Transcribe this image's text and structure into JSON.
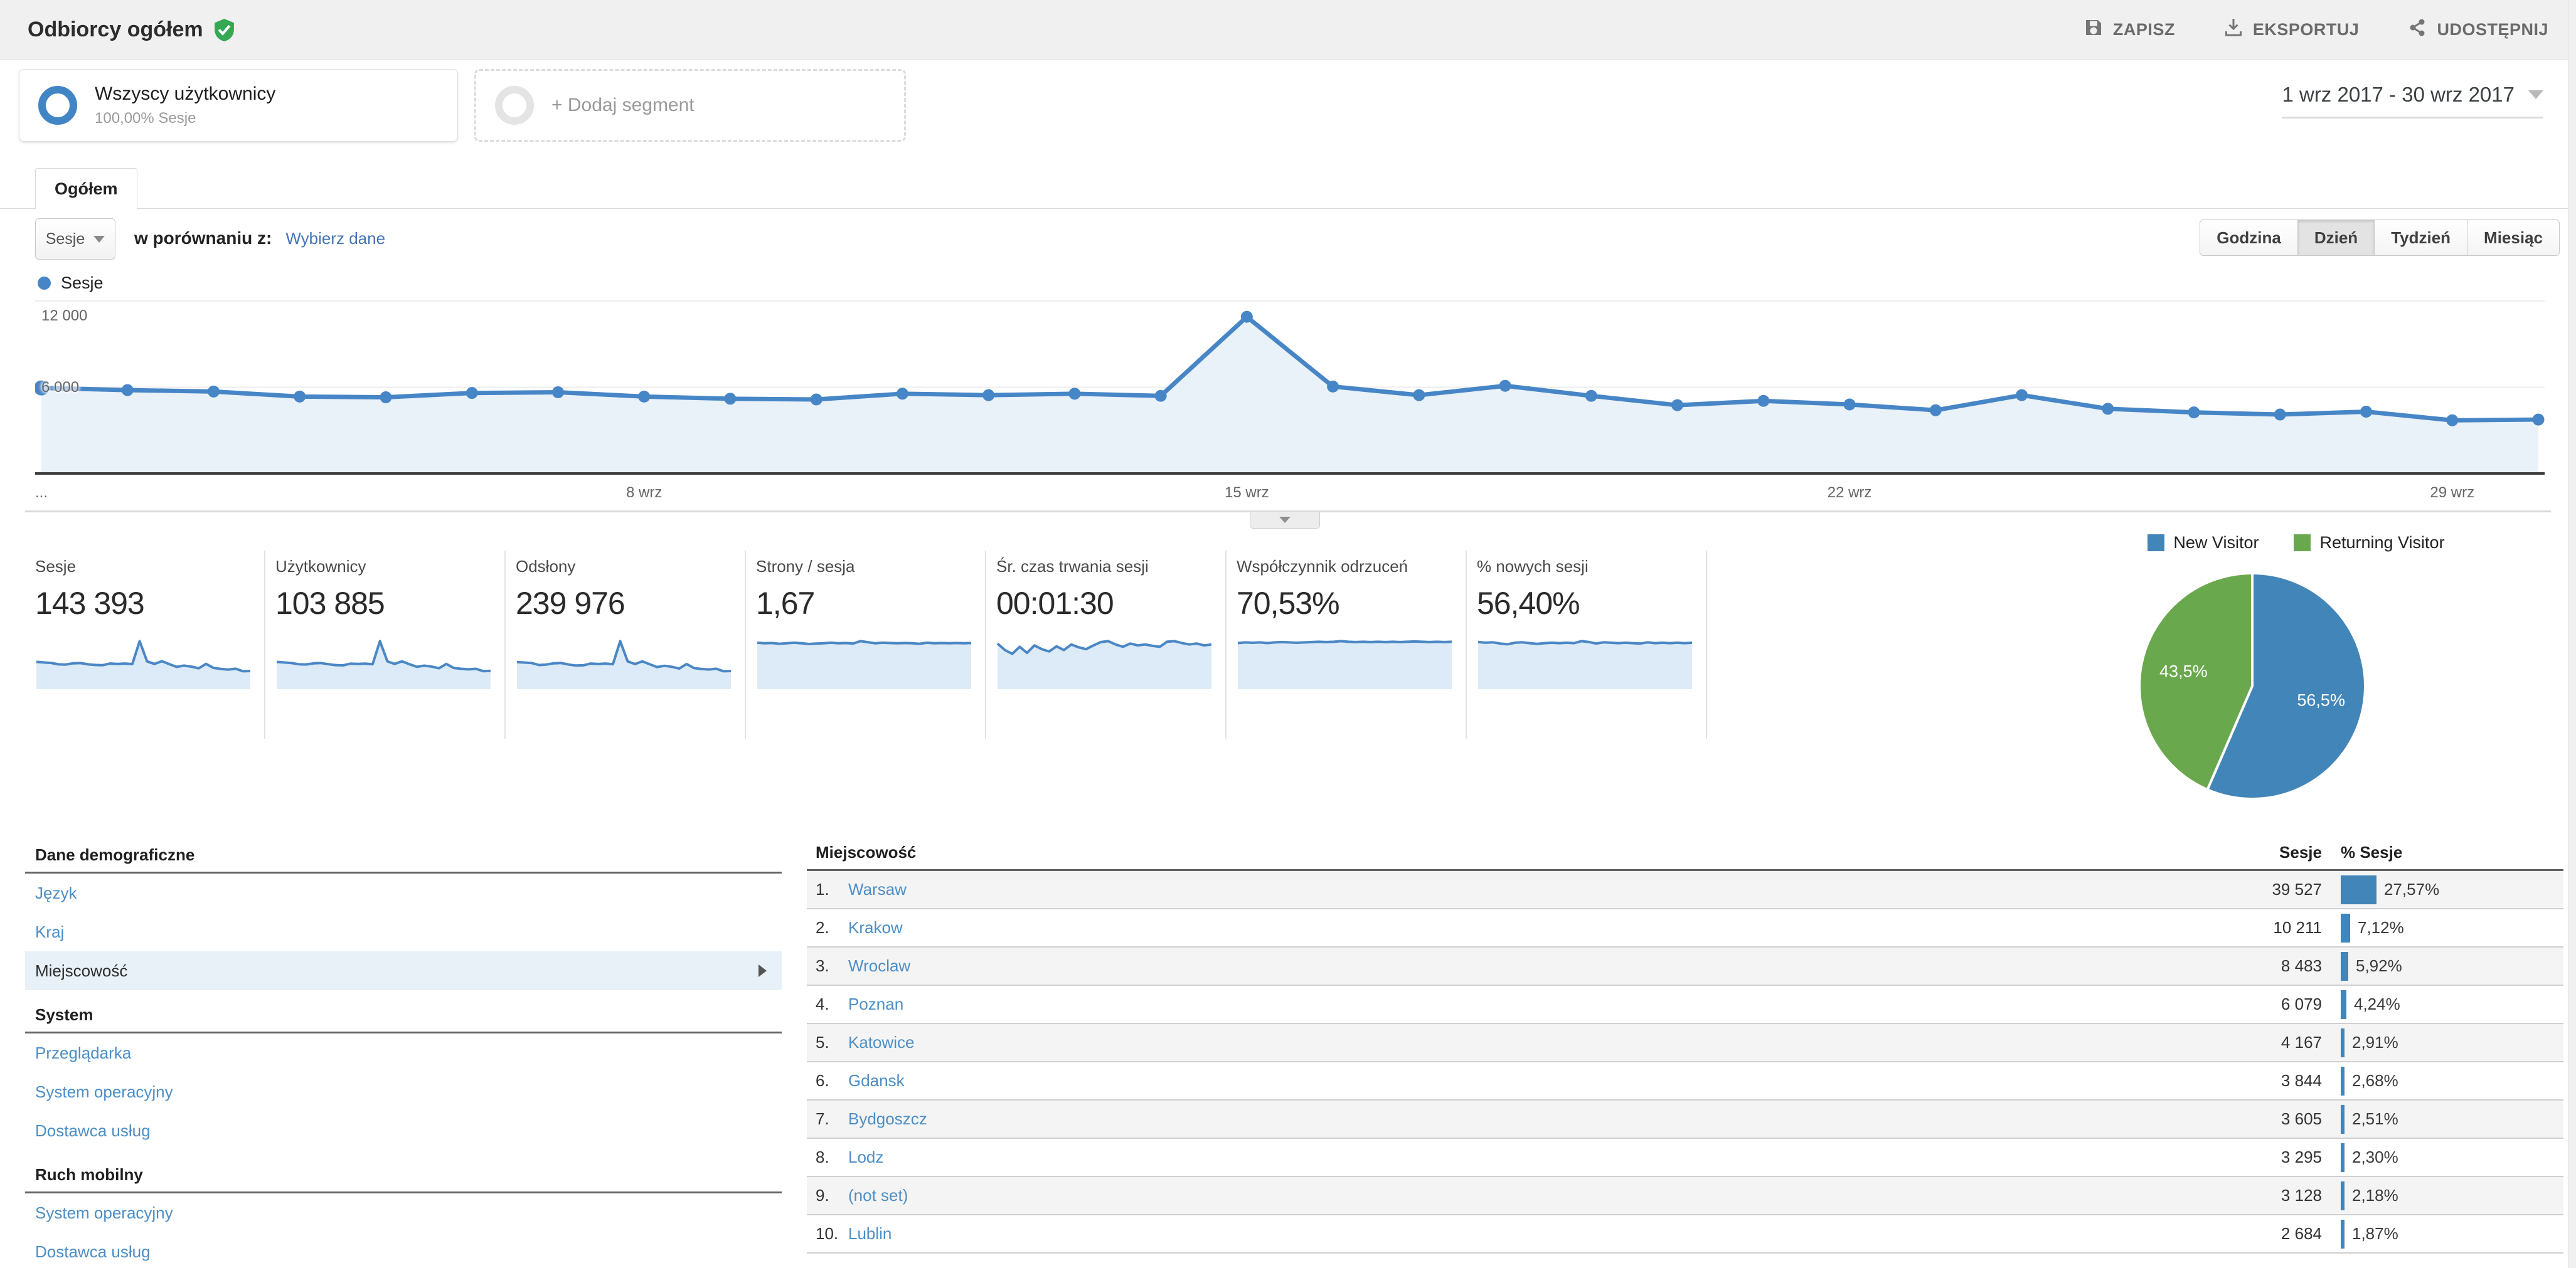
{
  "header": {
    "title": "Odbiorcy ogółem",
    "verified_icon": "shield-check-icon",
    "actions": [
      {
        "id": "save",
        "icon": "save-icon",
        "label": "ZAPISZ"
      },
      {
        "id": "export",
        "icon": "download-icon",
        "label": "EKSPORTUJ"
      },
      {
        "id": "share",
        "icon": "share-icon",
        "label": "UDOSTĘPNIJ"
      }
    ]
  },
  "segments": {
    "active": {
      "name": "Wszyscy użytkownicy",
      "detail": "100,00% Sesje"
    },
    "add_label": "+ Dodaj segment"
  },
  "date_range": "1 wrz 2017 - 30 wrz 2017",
  "tab_label": "Ogółem",
  "controls": {
    "metric_select": "Sesje",
    "compare_label": "w porównaniu z:",
    "compare_link": "Wybierz dane",
    "granularity": [
      "Godzina",
      "Dzień",
      "Tydzień",
      "Miesiąc"
    ],
    "granularity_active": "Dzień"
  },
  "colors": {
    "line_blue": "#4786c6",
    "area_blue": "#e9f1f9",
    "pie_blue": "#4285b8",
    "pie_green": "#6aa84e",
    "bar_blue": "#4285b8"
  },
  "chart_data": [
    {
      "id": "sessions_daily",
      "type": "line",
      "title": "Sesje",
      "x_unit": "day of wrz 2017",
      "x": [
        1,
        2,
        3,
        4,
        5,
        6,
        7,
        8,
        9,
        10,
        11,
        12,
        13,
        14,
        15,
        16,
        17,
        18,
        19,
        20,
        21,
        22,
        23,
        24,
        25,
        26,
        27,
        28,
        29,
        30
      ],
      "series": [
        {
          "name": "Sesje",
          "values": [
            5950,
            5800,
            5700,
            5350,
            5300,
            5600,
            5650,
            5350,
            5200,
            5150,
            5550,
            5450,
            5550,
            5400,
            10900,
            6050,
            5450,
            6100,
            5400,
            4750,
            5050,
            4800,
            4400,
            5450,
            4500,
            4250,
            4100,
            4300,
            3700,
            3750
          ]
        }
      ],
      "ylim": [
        0,
        13100
      ],
      "yticks": [
        {
          "value": 6000,
          "label": "6 000"
        },
        {
          "value": 12000,
          "label": "12 000"
        }
      ],
      "xticks": [
        {
          "index": 7,
          "label": "8 wrz"
        },
        {
          "index": 14,
          "label": "15 wrz"
        },
        {
          "index": 21,
          "label": "22 wrz"
        },
        {
          "index": 28,
          "label": "29 wrz"
        }
      ],
      "leading_xtick_label": "...",
      "grid": true,
      "legend_position": "top-left"
    },
    {
      "id": "visitor_type",
      "type": "pie",
      "slices": [
        {
          "label": "New Visitor",
          "value": 56.5,
          "display": "56,5%",
          "color": "#4285b8"
        },
        {
          "label": "Returning Visitor",
          "value": 43.5,
          "display": "43,5%",
          "color": "#6aa84e"
        }
      ],
      "legend_position": "top"
    }
  ],
  "metrics": [
    {
      "label": "Sesje",
      "value": "143 393",
      "spark": [
        5950,
        5800,
        5700,
        5350,
        5300,
        5600,
        5650,
        5350,
        5200,
        5150,
        5550,
        5450,
        5550,
        5400,
        10900,
        6050,
        5450,
        6100,
        5400,
        4750,
        5050,
        4800,
        4400,
        5450,
        4500,
        4250,
        4100,
        4300,
        3700,
        3750
      ]
    },
    {
      "label": "Użytkownicy",
      "value": "103 885",
      "spark": [
        4300,
        4200,
        4100,
        3900,
        3850,
        4050,
        4100,
        3900,
        3750,
        3700,
        4000,
        3950,
        4000,
        3900,
        7900,
        4400,
        3950,
        4400,
        3900,
        3450,
        3650,
        3500,
        3200,
        3950,
        3250,
        3100,
        3000,
        3100,
        2700,
        2750
      ]
    },
    {
      "label": "Odsłony",
      "value": "239 976",
      "spark": [
        9900,
        9700,
        9500,
        8700,
        8900,
        9400,
        9500,
        8900,
        8500,
        8600,
        9300,
        9100,
        9300,
        9000,
        18300,
        10200,
        9100,
        10200,
        9000,
        7900,
        8400,
        8000,
        7300,
        9100,
        7500,
        7100,
        6900,
        7200,
        6200,
        6300
      ]
    },
    {
      "label": "Strony / sesja",
      "value": "1,67",
      "spark": [
        1.68,
        1.66,
        1.67,
        1.64,
        1.66,
        1.68,
        1.66,
        1.63,
        1.65,
        1.66,
        1.68,
        1.66,
        1.67,
        1.65,
        1.74,
        1.7,
        1.66,
        1.68,
        1.67,
        1.66,
        1.67,
        1.66,
        1.64,
        1.68,
        1.66,
        1.67,
        1.66,
        1.67,
        1.66,
        1.67
      ]
    },
    {
      "label": "Śr. czas trwania sesji",
      "value": "00:01:30",
      "spark": [
        92,
        78,
        70,
        85,
        72,
        88,
        80,
        75,
        86,
        78,
        90,
        84,
        80,
        88,
        95,
        97,
        90,
        85,
        92,
        88,
        90,
        87,
        85,
        96,
        97,
        93,
        90,
        92,
        88,
        90
      ]
    },
    {
      "label": "Współczynnik odrzuceń",
      "value": "70,53%",
      "spark": [
        69,
        70,
        69.5,
        70,
        69,
        70,
        70.5,
        70,
        69.5,
        70,
        70.5,
        71,
        70.5,
        71,
        72,
        71,
        70.5,
        71,
        70.5,
        71,
        70.5,
        71,
        70.5,
        71,
        71.5,
        71,
        70.5,
        71,
        70.5,
        71
      ]
    },
    {
      "label": "% nowych sesji",
      "value": "56,40%",
      "spark": [
        57,
        56,
        56.5,
        55,
        54,
        56,
        56.5,
        55.5,
        54.5,
        55.5,
        56,
        55.5,
        56,
        55.5,
        58,
        57,
        55,
        56.5,
        56,
        55.5,
        56,
        55.5,
        55,
        56.5,
        55.5,
        56,
        55.5,
        56,
        55.5,
        56
      ]
    }
  ],
  "nav": {
    "sections": [
      {
        "title": "Dane demograficzne",
        "items": [
          {
            "id": "jezyk",
            "label": "Język"
          },
          {
            "id": "kraj",
            "label": "Kraj"
          },
          {
            "id": "miejscowosc",
            "label": "Miejscowość",
            "selected": true
          }
        ]
      },
      {
        "title": "System",
        "items": [
          {
            "id": "przegladarka",
            "label": "Przeglądarka"
          },
          {
            "id": "system-operacyjny",
            "label": "System operacyjny"
          },
          {
            "id": "dostawca-uslug",
            "label": "Dostawca usług"
          }
        ]
      },
      {
        "title": "Ruch mobilny",
        "items": [
          {
            "id": "mobilny-system-operacyjny",
            "label": "System operacyjny"
          },
          {
            "id": "mobilny-dostawca-uslug",
            "label": "Dostawca usług"
          }
        ]
      }
    ]
  },
  "table": {
    "headers": [
      "Miejscowość",
      "Sesje",
      "% Sesje"
    ],
    "rows": [
      {
        "rank": "1.",
        "city": "Warsaw",
        "sessions": "39 527",
        "pct": 27.57,
        "pct_display": "27,57%"
      },
      {
        "rank": "2.",
        "city": "Krakow",
        "sessions": "10 211",
        "pct": 7.12,
        "pct_display": "7,12%"
      },
      {
        "rank": "3.",
        "city": "Wroclaw",
        "sessions": "8 483",
        "pct": 5.92,
        "pct_display": "5,92%"
      },
      {
        "rank": "4.",
        "city": "Poznan",
        "sessions": "6 079",
        "pct": 4.24,
        "pct_display": "4,24%"
      },
      {
        "rank": "5.",
        "city": "Katowice",
        "sessions": "4 167",
        "pct": 2.91,
        "pct_display": "2,91%"
      },
      {
        "rank": "6.",
        "city": "Gdansk",
        "sessions": "3 844",
        "pct": 2.68,
        "pct_display": "2,68%"
      },
      {
        "rank": "7.",
        "city": "Bydgoszcz",
        "sessions": "3 605",
        "pct": 2.51,
        "pct_display": "2,51%"
      },
      {
        "rank": "8.",
        "city": "Lodz",
        "sessions": "3 295",
        "pct": 2.3,
        "pct_display": "2,30%"
      },
      {
        "rank": "9.",
        "city": "(not set)",
        "sessions": "3 128",
        "pct": 2.18,
        "pct_display": "2,18%"
      },
      {
        "rank": "10.",
        "city": "Lublin",
        "sessions": "2 684",
        "pct": 1.87,
        "pct_display": "1,87%"
      }
    ]
  }
}
